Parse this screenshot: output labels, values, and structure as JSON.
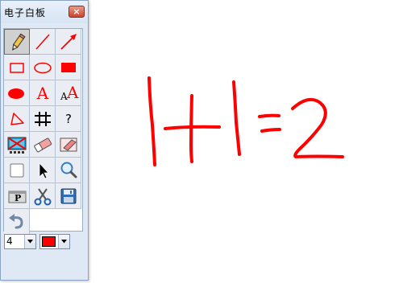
{
  "window": {
    "title": "电子白板",
    "close_label": "×"
  },
  "tools": {
    "font_small_big_a": "A",
    "font_big_a": "A",
    "font_small_a": "A",
    "help_label": "?",
    "page_label": "P"
  },
  "line_width": {
    "value": "4",
    "options": [
      "4"
    ]
  },
  "pen_color": {
    "value": "#ff0000"
  },
  "canvas": {
    "ink_color": "#ff0000",
    "content": "1+1=2"
  },
  "colors": {
    "accent": "#ff0000",
    "window_bg": "#dfe9f5",
    "selected_tool_bg": "#d0d0d0"
  }
}
